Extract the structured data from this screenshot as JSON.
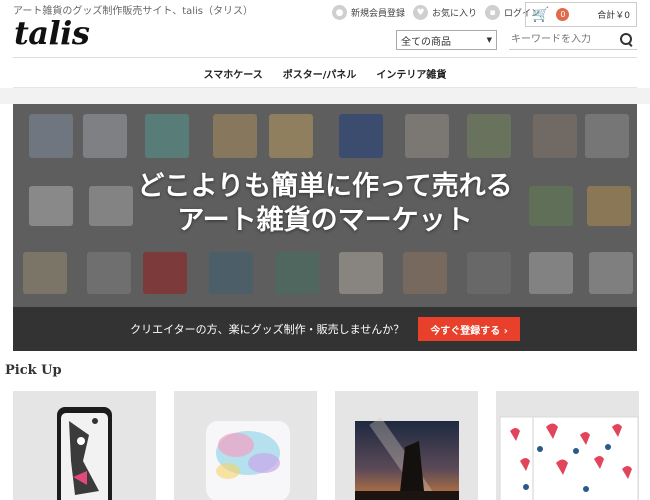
{
  "header": {
    "tagline": "アート雑貨のグッズ制作販売サイト、talis（タリス）",
    "logo": "talis",
    "links": {
      "register": "新規会員登録",
      "favorites": "お気に入り",
      "login": "ログイン"
    },
    "cart": {
      "count": "0",
      "total": "合計￥0"
    },
    "category": {
      "selected": "全ての商品"
    },
    "search": {
      "placeholder": "キーワードを入力"
    }
  },
  "nav": {
    "items": [
      "スマホケース",
      "ポスター/パネル",
      "インテリア雑貨"
    ]
  },
  "hero": {
    "title_line1": "どこよりも簡単に作って売れる",
    "title_line2": "アート雑貨のマーケット",
    "cta_text": "クリエイターの方、楽にグッズ制作・販売しませんか？",
    "cta_button": "今すぐ登録する ›"
  },
  "pickup": {
    "title": "Pick Up"
  },
  "colors": {
    "accent": "#e8402a",
    "cart_badge": "#e06b4b",
    "cta_bar": "#333333"
  },
  "icons": [
    "user-icon",
    "heart-icon",
    "lock-icon",
    "cart-icon",
    "search-icon",
    "chevron-down-icon"
  ]
}
